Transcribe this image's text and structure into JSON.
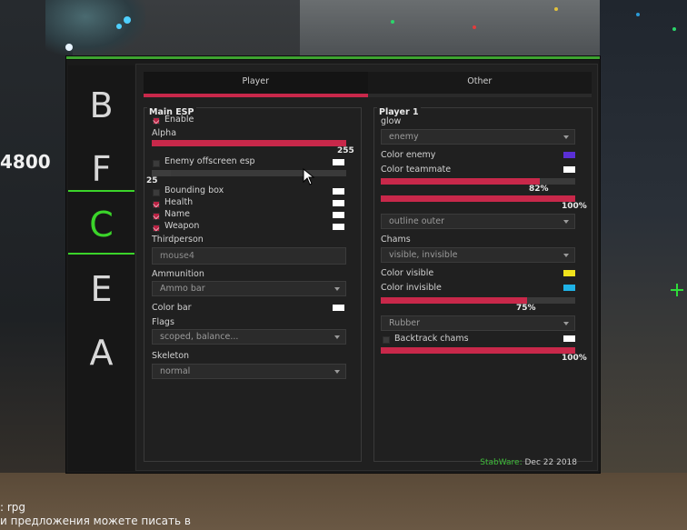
{
  "background": {
    "hud_money": "4800",
    "chat_lines": [
      ": rpg",
      "и предложения можете писать в"
    ]
  },
  "colors": {
    "accent_green": "#3bd42a",
    "accent_red": "#c8284a",
    "enemy_color": "#5a2fd6",
    "visible_color": "#f0e21c",
    "invisible_color": "#1fb2e6",
    "white_swatch": "#ffffff"
  },
  "sidebar": {
    "items": [
      {
        "label": "B",
        "active": false
      },
      {
        "label": "F",
        "active": false
      },
      {
        "label": "C",
        "active": true
      },
      {
        "label": "E",
        "active": false
      },
      {
        "label": "A",
        "active": false
      }
    ]
  },
  "tabs": {
    "player": "Player",
    "other": "Other",
    "active": "player"
  },
  "main_esp": {
    "title": "Main ESP",
    "enable_label": "Enable",
    "enable_checked": true,
    "alpha_label": "Alpha",
    "alpha_value": "255",
    "alpha_fraction": 1.0,
    "offscreen_label": "Enemy offscreen esp",
    "offscreen_checked": false,
    "offscreen_value": "25",
    "offscreen_fraction": 0.1,
    "bbox_label": "Bounding box",
    "bbox_checked": false,
    "health_label": "Health",
    "health_checked": true,
    "name_label": "Name",
    "name_checked": true,
    "weapon_label": "Weapon",
    "weapon_checked": true,
    "thirdperson_label": "Thirdperson",
    "thirdperson_key": "mouse4",
    "ammunition_label": "Ammunition",
    "ammunition_value": "Ammo bar",
    "colorbar_label": "Color bar",
    "flags_label": "Flags",
    "flags_value": "scoped, balance...",
    "skeleton_label": "Skeleton",
    "skeleton_value": "normal"
  },
  "player1": {
    "title": "Player 1",
    "glow_label": "glow",
    "glow_target": "enemy",
    "color_enemy_label": "Color enemy",
    "color_teammate_label": "Color teammate",
    "glow_alpha_value": "82%",
    "glow_alpha_fraction": 0.82,
    "glow_alpha2_value": "100%",
    "glow_alpha2_fraction": 1.0,
    "glow_style": "outline outer",
    "chams_label": "Chams",
    "chams_mode": "visible, invisible",
    "color_visible_label": "Color visible",
    "color_invisible_label": "Color invisible",
    "chams_alpha_value": "75%",
    "chams_alpha_fraction": 0.75,
    "chams_material": "Rubber",
    "backtrack_label": "Backtrack chams",
    "backtrack_checked": false,
    "backtrack_alpha_value": "100%",
    "backtrack_alpha_fraction": 1.0
  },
  "footer": {
    "brand": "StabWare:",
    "date": "Dec 22 2018"
  }
}
